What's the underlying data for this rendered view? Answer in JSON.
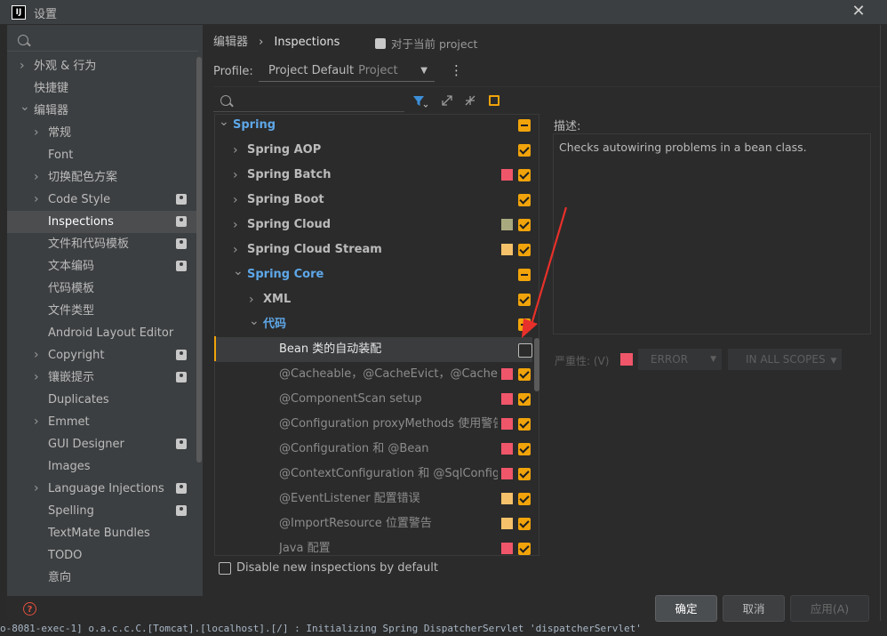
{
  "window": {
    "title": "设置"
  },
  "sidebar": {
    "items": [
      {
        "label": "外观 & 行为",
        "chev": "right",
        "level": 0,
        "selected": false,
        "badge": false
      },
      {
        "label": "快捷键",
        "chev": "",
        "level": 0,
        "selected": false,
        "badge": false
      },
      {
        "label": "编辑器",
        "chev": "down",
        "level": 0,
        "selected": false,
        "badge": false
      },
      {
        "label": "常规",
        "chev": "right",
        "level": 1,
        "selected": false,
        "badge": false
      },
      {
        "label": "Font",
        "chev": "",
        "level": 1,
        "selected": false,
        "badge": false
      },
      {
        "label": "切换配色方案",
        "chev": "right",
        "level": 1,
        "selected": false,
        "badge": false
      },
      {
        "label": "Code Style",
        "chev": "right",
        "level": 1,
        "selected": false,
        "badge": true
      },
      {
        "label": "Inspections",
        "chev": "",
        "level": 1,
        "selected": true,
        "badge": true
      },
      {
        "label": "文件和代码模板",
        "chev": "",
        "level": 1,
        "selected": false,
        "badge": true
      },
      {
        "label": "文本编码",
        "chev": "",
        "level": 1,
        "selected": false,
        "badge": true
      },
      {
        "label": "代码模板",
        "chev": "",
        "level": 1,
        "selected": false,
        "badge": false
      },
      {
        "label": "文件类型",
        "chev": "",
        "level": 1,
        "selected": false,
        "badge": false
      },
      {
        "label": "Android Layout Editor",
        "chev": "",
        "level": 1,
        "selected": false,
        "badge": false
      },
      {
        "label": "Copyright",
        "chev": "right",
        "level": 1,
        "selected": false,
        "badge": true
      },
      {
        "label": "镶嵌提示",
        "chev": "right",
        "level": 1,
        "selected": false,
        "badge": true
      },
      {
        "label": "Duplicates",
        "chev": "",
        "level": 1,
        "selected": false,
        "badge": false
      },
      {
        "label": "Emmet",
        "chev": "right",
        "level": 1,
        "selected": false,
        "badge": false
      },
      {
        "label": "GUI Designer",
        "chev": "",
        "level": 1,
        "selected": false,
        "badge": true
      },
      {
        "label": "Images",
        "chev": "",
        "level": 1,
        "selected": false,
        "badge": false
      },
      {
        "label": "Language Injections",
        "chev": "right",
        "level": 1,
        "selected": false,
        "badge": true
      },
      {
        "label": "Spelling",
        "chev": "",
        "level": 1,
        "selected": false,
        "badge": true
      },
      {
        "label": "TextMate Bundles",
        "chev": "",
        "level": 1,
        "selected": false,
        "badge": false
      },
      {
        "label": "TODO",
        "chev": "",
        "level": 1,
        "selected": false,
        "badge": false
      },
      {
        "label": "意向",
        "chev": "",
        "level": 1,
        "selected": false,
        "badge": false
      }
    ]
  },
  "breadcrumb": {
    "parent": "编辑器",
    "sep": "›",
    "current": "Inspections"
  },
  "project_note": "对于当前 project",
  "profile": {
    "label": "Profile:",
    "value": "Project Default",
    "sub": "Project"
  },
  "tree": [
    {
      "label": "Spring",
      "level": 0,
      "chev": "down",
      "style": "blue",
      "swatch": "",
      "check": "part"
    },
    {
      "label": "Spring AOP",
      "level": 1,
      "chev": "right",
      "style": "group",
      "swatch": "",
      "check": "on"
    },
    {
      "label": "Spring Batch",
      "level": 1,
      "chev": "right",
      "style": "group",
      "swatch": "#f0566a",
      "check": "on"
    },
    {
      "label": "Spring Boot",
      "level": 1,
      "chev": "right",
      "style": "group",
      "swatch": "",
      "check": "on"
    },
    {
      "label": "Spring Cloud",
      "level": 1,
      "chev": "right",
      "style": "group",
      "swatch": "#a9a97f",
      "check": "on"
    },
    {
      "label": "Spring Cloud Stream",
      "level": 1,
      "chev": "right",
      "style": "group",
      "swatch": "#f5c26b",
      "check": "on"
    },
    {
      "label": "Spring Core",
      "level": 1,
      "chev": "down",
      "style": "blue",
      "swatch": "",
      "check": "part"
    },
    {
      "label": "XML",
      "level": 2,
      "chev": "right",
      "style": "group",
      "swatch": "",
      "check": "on"
    },
    {
      "label": "代码",
      "level": 2,
      "chev": "down",
      "style": "blue",
      "swatch": "",
      "check": "part"
    },
    {
      "label": "Bean 类的自动装配",
      "level": 3,
      "chev": "",
      "style": "white",
      "swatch": "",
      "check": "off",
      "selected": true
    },
    {
      "label": "@Cacheable，@CacheEvict，@CachePut，",
      "level": 3,
      "chev": "",
      "style": "dim",
      "swatch": "#f0566a",
      "check": "on"
    },
    {
      "label": "@ComponentScan setup",
      "level": 3,
      "chev": "",
      "style": "dim",
      "swatch": "#f0566a",
      "check": "on"
    },
    {
      "label": "@Configuration proxyMethods 使用警告",
      "level": 3,
      "chev": "",
      "style": "dim",
      "swatch": "#f0566a",
      "check": "on"
    },
    {
      "label": "@Configuration 和 @Bean",
      "level": 3,
      "chev": "",
      "style": "dim",
      "swatch": "#f0566a",
      "check": "on"
    },
    {
      "label": "@ContextConfiguration 和 @SqlConfig 警告",
      "level": 3,
      "chev": "",
      "style": "dim",
      "swatch": "#f0566a",
      "check": "on"
    },
    {
      "label": "@EventListener 配置错误",
      "level": 3,
      "chev": "",
      "style": "dim",
      "swatch": "#f5c26b",
      "check": "on"
    },
    {
      "label": "@ImportResource 位置警告",
      "level": 3,
      "chev": "",
      "style": "dim",
      "swatch": "#f5c26b",
      "check": "on"
    },
    {
      "label": "Java 配置",
      "level": 3,
      "chev": "",
      "style": "dim",
      "swatch": "#f0566a",
      "check": "on"
    }
  ],
  "description": {
    "label": "描述:",
    "text": "Checks autowiring problems in a bean class."
  },
  "severity": {
    "label": "严重性:",
    "mnemonic": "(V)",
    "value": "ERROR",
    "color": "#f0566a",
    "scope": "IN ALL SCOPES"
  },
  "disable_new": "Disable new inspections by default",
  "buttons": {
    "ok": "确定",
    "cancel": "取消",
    "apply": "应用(A)"
  },
  "console_line": "o-8081-exec-1] o.a.c.c.C.[Tomcat].[localhost].[/]       : Initializing Spring DispatcherServlet 'dispatcherServlet'",
  "colors": {
    "accent": "#f0a30a",
    "link": "#5ea7e8",
    "error": "#f0566a",
    "warning": "#f5c26b",
    "annotation_arrow": "#e8302a"
  }
}
